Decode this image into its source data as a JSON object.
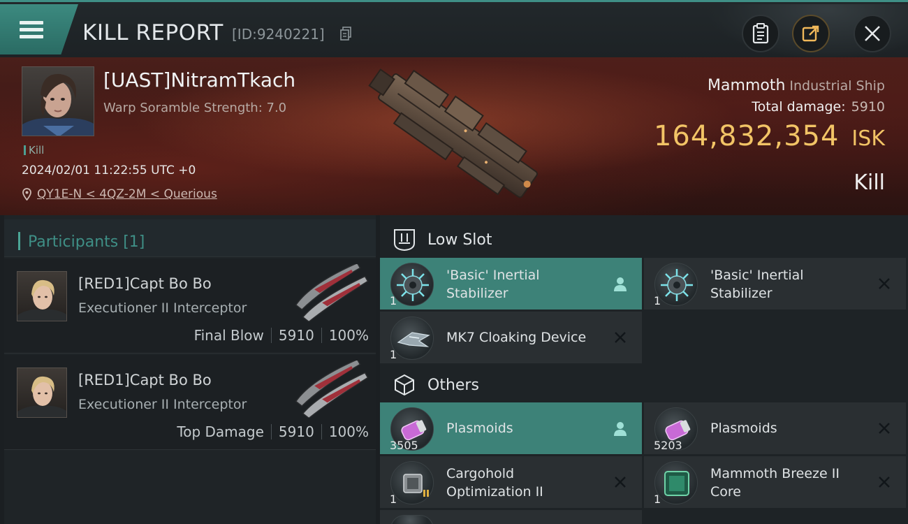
{
  "header": {
    "title": "KILL REPORT",
    "report_id": "[ID:9240221]"
  },
  "victim": {
    "name": "[UAST]NitramTkach",
    "scramble": "Warp Soramble Strength: 7.0",
    "kill_tag": "Kill",
    "datetime": "2024/02/01 11:22:55 UTC +0",
    "location": "QY1E-N < 4QZ-2M < Querious",
    "ship_name": "Mammoth",
    "ship_class": "Industrial Ship",
    "total_damage_label": "Total damage:",
    "total_damage": "5910",
    "isk_value": "164,832,354",
    "isk_unit": "ISK",
    "result": "Kill"
  },
  "participants": {
    "heading": "Participants [1]",
    "rows": [
      {
        "name": "[RED1]Capt Bo Bo",
        "ship": "Executioner II Interceptor",
        "role": "Final Blow",
        "damage": "5910",
        "percent": "100%"
      },
      {
        "name": "[RED1]Capt Bo Bo",
        "ship": "Executioner II Interceptor",
        "role": "Top Damage",
        "damage": "5910",
        "percent": "100%"
      }
    ]
  },
  "sections": {
    "low_slot": "Low Slot",
    "others": "Others"
  },
  "items": {
    "low": [
      {
        "name_1": "'Basic' Inertial",
        "name_2": "Stabilizer",
        "qty": "1"
      },
      {
        "name_1": "'Basic' Inertial",
        "name_2": "Stabilizer",
        "qty": "1"
      },
      {
        "name_1": "MK7 Cloaking Device",
        "qty": "1"
      }
    ],
    "others": [
      {
        "name_1": "Plasmoids",
        "qty": "3505"
      },
      {
        "name_1": "Plasmoids",
        "qty": "5203"
      },
      {
        "name_1": "Cargohold",
        "name_2": "Optimization II",
        "qty": "1"
      },
      {
        "name_1": "Mammoth Breeze II",
        "name_2": "Core",
        "qty": "1"
      }
    ]
  },
  "colors": {
    "accent": "#3f8f86",
    "isk": "#f2c466",
    "active_cell": "#3d8278"
  }
}
